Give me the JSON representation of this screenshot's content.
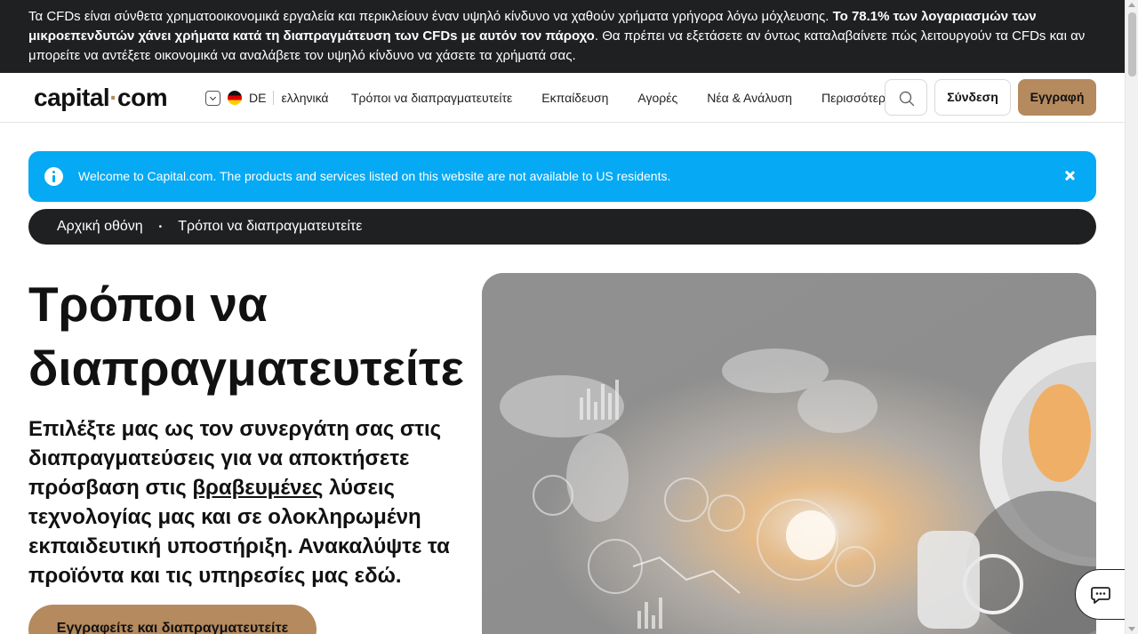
{
  "risk_banner": {
    "text_1": "Τα CFDs είναι σύνθετα χρηματοοικονομικά εργαλεία και περικλείουν έναν υψηλό κίνδυνο να χαθούν χρήματα γρήγορα λόγω μόχλευσης. ",
    "text_bold": "Το 78.1% των λογαριασμών των μικροεπενδυτών χάνει χρήματα κατά τη διαπραγμάτευση των CFDs με αυτόν τον πάροχο",
    "text_2": ". Θα πρέπει να εξετάσετε αν όντως καταλαβαίνετε πώς λειτουργούν τα CFDs και αν μπορείτε να αντέξετε οικονομικά να αναλάβετε τον υψηλό κίνδυνο να χάσετε τα χρήματά σας."
  },
  "header": {
    "logo_left": "capital",
    "logo_dot": "·",
    "logo_right": "com",
    "lang_code": "DE",
    "lang_name": "ελληνικά",
    "nav": [
      "Τρόποι να διαπραγματευτείτε",
      "Εκπαίδευση",
      "Αγορές",
      "Νέα & Ανάλυση",
      "Περισσότερα"
    ],
    "login_label": "Σύνδεση",
    "signup_label": "Εγγραφή"
  },
  "alert": {
    "text": "Welcome to Capital.com. The products and services listed on this website are not available to US residents."
  },
  "breadcrumb": {
    "home": "Αρχική οθόνη",
    "separator": "•",
    "current": "Τρόποι να διαπραγματευτείτε"
  },
  "hero": {
    "title": "Τρόποι να διαπραγματευτείτε",
    "desc_1": "Επιλέξτε μας ως τον συνεργάτη σας στις διαπραγματεύσεις για να αποκτήσετε πρόσβαση στις ",
    "desc_link": "βραβευμένες",
    "desc_2": " λύσεις τεχνολογίας μας και σε ολοκληρωμένη εκπαιδευτική υποστήριξη. Ανακαλύψτε τα προϊόντα και τις υπηρεσίες μας εδώ.",
    "cta_label": "Εγγραφείτε και διαπραγματευτείτε"
  },
  "colors": {
    "brand_accent": "#b58a5e",
    "alert_blue": "#05a9f4",
    "dark": "#1f2022"
  }
}
